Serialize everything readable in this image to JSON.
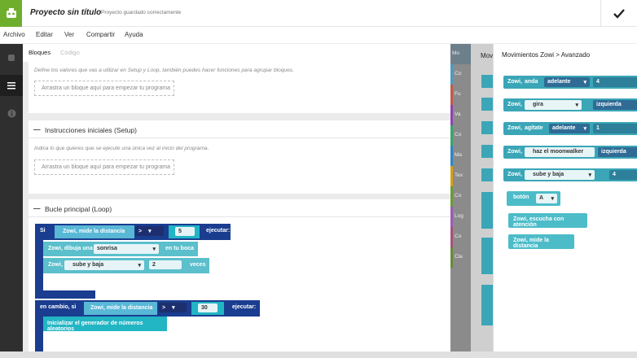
{
  "header": {
    "title": "Proyecto sin título",
    "status": "Proyecto guardado correctamente"
  },
  "menu": [
    "Archivo",
    "Editar",
    "Ver",
    "Compartir",
    "Ayuda"
  ],
  "tabs": {
    "blocks": "Bloques",
    "code": "Código"
  },
  "sections": {
    "vars": {
      "hint": "Define los valores que vas a utilizar en Setup y Loop, también puedes hacer funciones para agrupar bloques.",
      "drop": "Arrastra un bloque aquí para empezar tu programa"
    },
    "setup": {
      "title": "Instrucciones iniciales (Setup)",
      "hint": "Indica lo que quieres que se ejecute una única vez al inicio del programa.",
      "drop": "Arrastra un bloque aquí para empezar tu programa"
    },
    "loop": {
      "title": "Bucle principal (Loop)"
    }
  },
  "loop_blocks": {
    "if_label": "Si",
    "distance1": "Zowi, mide la distancia",
    "op1": ">",
    "val1": "5",
    "execute1": "ejecutar:",
    "draw_label": "Zowi, dibuja una",
    "draw_value": "sonrisa",
    "draw_tail": "en tu boca",
    "zowi_label": "Zowi,",
    "updown": "sube y baja",
    "times_val": "2",
    "times": "veces",
    "else_label": "en cambio, si",
    "distance2": "Zowi, mide la distancia",
    "op2": ">",
    "val2": "30",
    "execute2": "ejecutar:",
    "random_init": "Inicializar el generador de números aleatorios"
  },
  "categories": [
    "Mo",
    "Co",
    "Fu",
    "Va",
    "Co",
    "Ma",
    "Tex",
    "Co",
    "Log",
    "Co",
    "Cla"
  ],
  "strip_label": "Mov",
  "flyout": {
    "title": "Movimientos Zowi > Avanzado",
    "b1": {
      "a": "Zowi,",
      "b": "anda",
      "c": "adelante",
      "d": "4"
    },
    "b2": {
      "a": "Zowi,",
      "b": "gira",
      "c": "izquierda"
    },
    "b3": {
      "a": "Zowi,",
      "b": "agítate",
      "c": "adelante",
      "d": "1"
    },
    "b4": {
      "a": "Zowi,",
      "b": "haz el moonwalker",
      "c": "izquierda"
    },
    "b5": {
      "a": "Zowi,",
      "b": "sube y baja",
      "d": "4"
    },
    "b6": {
      "a": "botón",
      "b": "A"
    },
    "b7": "Zowi, escucha con atención",
    "b8": "Zowi, mide la distancia"
  },
  "colors": {
    "brand": "#6fae2c",
    "navy": "#1a3d8f",
    "light_blue": "#58b8d6",
    "teal": "#22b5c4"
  },
  "icons": [
    "zowi-logo-icon",
    "check-icon",
    "robot-icon",
    "list-icon",
    "info-icon",
    "minus-icon",
    "chevron-down-icon"
  ]
}
